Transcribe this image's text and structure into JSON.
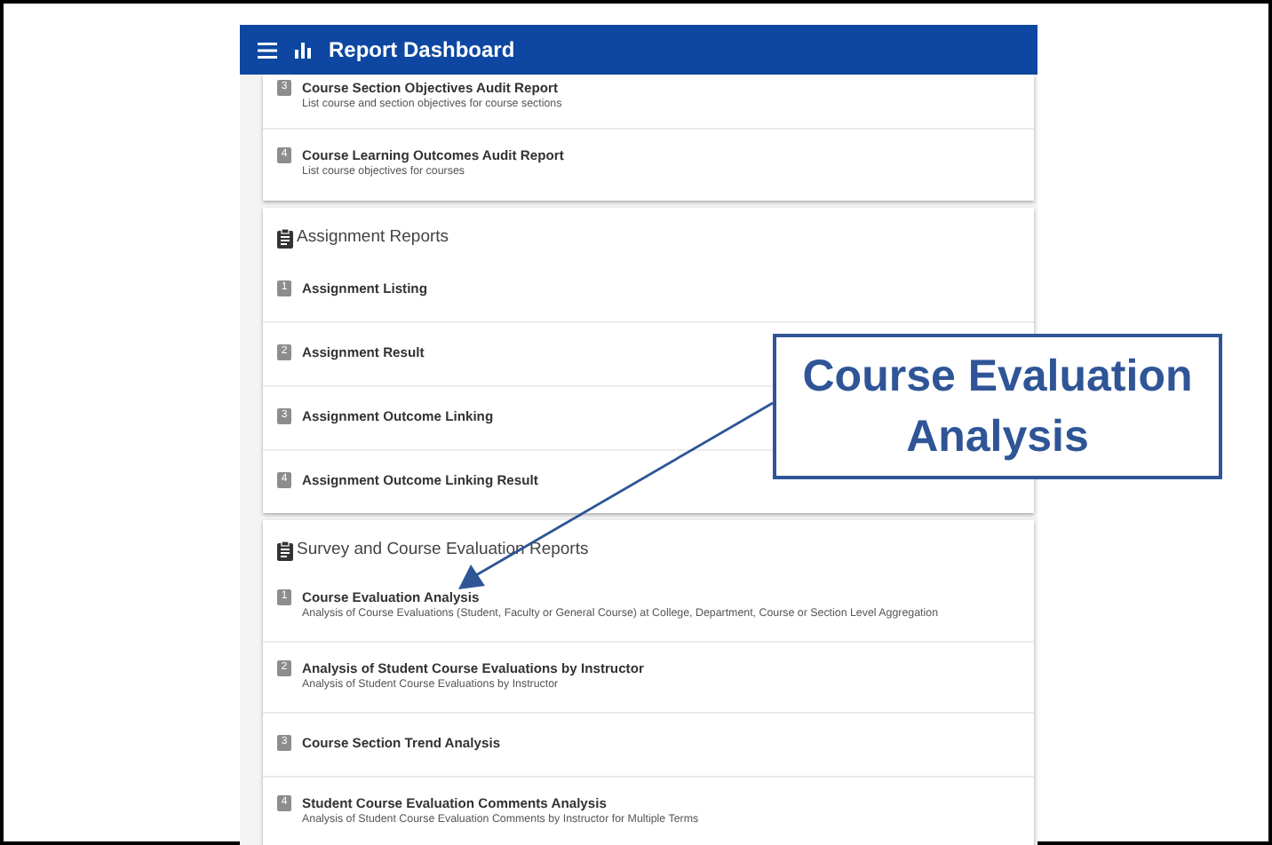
{
  "app_bar": {
    "title": "Report Dashboard"
  },
  "sections": [
    {
      "items": [
        {
          "number": "3",
          "title": "Course Section Objectives Audit Report",
          "description": "List course and section objectives for course sections"
        },
        {
          "number": "4",
          "title": "Course Learning Outcomes Audit Report",
          "description": "List course objectives for courses"
        }
      ]
    },
    {
      "title": "Assignment Reports",
      "items": [
        {
          "number": "1",
          "title": "Assignment Listing"
        },
        {
          "number": "2",
          "title": "Assignment Result"
        },
        {
          "number": "3",
          "title": "Assignment Outcome Linking"
        },
        {
          "number": "4",
          "title": "Assignment Outcome Linking Result"
        }
      ]
    },
    {
      "title": "Survey and Course Evaluation Reports",
      "items": [
        {
          "number": "1",
          "title": "Course Evaluation Analysis",
          "description": "Analysis of Course Evaluations (Student, Faculty or General Course) at College, Department, Course or Section Level Aggregation"
        },
        {
          "number": "2",
          "title": "Analysis of Student Course Evaluations by Instructor",
          "description": "Analysis of Student Course Evaluations by Instructor"
        },
        {
          "number": "3",
          "title": "Course Section Trend Analysis"
        },
        {
          "number": "4",
          "title": "Student Course Evaluation Comments Analysis",
          "description": "Analysis of Student Course Evaluation Comments by Instructor for Multiple Terms"
        }
      ]
    }
  ],
  "callout": {
    "text": "Course Evaluation Analysis"
  }
}
